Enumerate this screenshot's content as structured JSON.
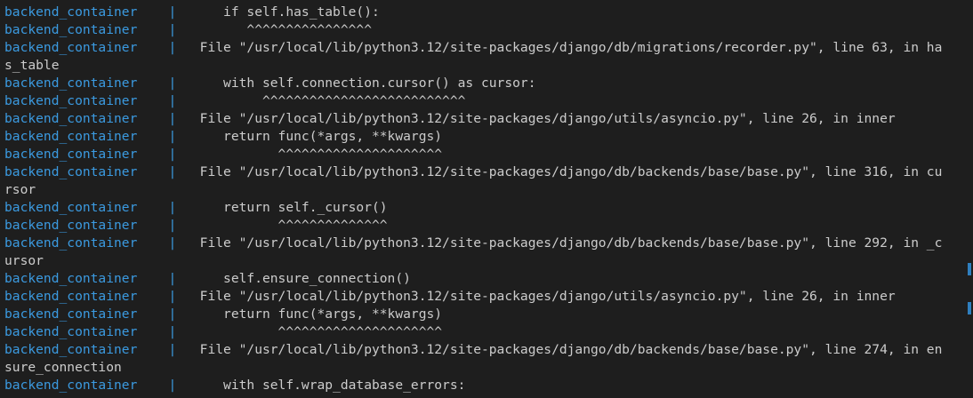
{
  "lines": [
    {
      "prefix": "backend_container",
      "pipe": "|",
      "text": "      if self.has_table():"
    },
    {
      "prefix": "backend_container",
      "pipe": "|",
      "text": "         ^^^^^^^^^^^^^^^^"
    },
    {
      "prefix": "backend_container",
      "pipe": "|",
      "text": "   File \"/usr/local/lib/python3.12/site-packages/django/db/migrations/recorder.py\", line 63, in ha"
    },
    {
      "prefix": "",
      "pipe": "",
      "text": "s_table"
    },
    {
      "prefix": "backend_container",
      "pipe": "|",
      "text": "      with self.connection.cursor() as cursor:"
    },
    {
      "prefix": "backend_container",
      "pipe": "|",
      "text": "           ^^^^^^^^^^^^^^^^^^^^^^^^^^"
    },
    {
      "prefix": "backend_container",
      "pipe": "|",
      "text": "   File \"/usr/local/lib/python3.12/site-packages/django/utils/asyncio.py\", line 26, in inner"
    },
    {
      "prefix": "backend_container",
      "pipe": "|",
      "text": "      return func(*args, **kwargs)"
    },
    {
      "prefix": "backend_container",
      "pipe": "|",
      "text": "             ^^^^^^^^^^^^^^^^^^^^^"
    },
    {
      "prefix": "backend_container",
      "pipe": "|",
      "text": "   File \"/usr/local/lib/python3.12/site-packages/django/db/backends/base/base.py\", line 316, in cu"
    },
    {
      "prefix": "",
      "pipe": "",
      "text": "rsor"
    },
    {
      "prefix": "backend_container",
      "pipe": "|",
      "text": "      return self._cursor()"
    },
    {
      "prefix": "backend_container",
      "pipe": "|",
      "text": "             ^^^^^^^^^^^^^^"
    },
    {
      "prefix": "backend_container",
      "pipe": "|",
      "text": "   File \"/usr/local/lib/python3.12/site-packages/django/db/backends/base/base.py\", line 292, in _c"
    },
    {
      "prefix": "",
      "pipe": "",
      "text": "ursor"
    },
    {
      "prefix": "backend_container",
      "pipe": "|",
      "text": "      self.ensure_connection()"
    },
    {
      "prefix": "backend_container",
      "pipe": "|",
      "text": "   File \"/usr/local/lib/python3.12/site-packages/django/utils/asyncio.py\", line 26, in inner"
    },
    {
      "prefix": "backend_container",
      "pipe": "|",
      "text": "      return func(*args, **kwargs)"
    },
    {
      "prefix": "backend_container",
      "pipe": "|",
      "text": "             ^^^^^^^^^^^^^^^^^^^^^"
    },
    {
      "prefix": "backend_container",
      "pipe": "|",
      "text": "   File \"/usr/local/lib/python3.12/site-packages/django/db/backends/base/base.py\", line 274, in en"
    },
    {
      "prefix": "",
      "pipe": "",
      "text": "sure_connection"
    },
    {
      "prefix": "backend_container",
      "pipe": "|",
      "text": "      with self.wrap_database_errors:"
    }
  ],
  "colors": {
    "background": "#1e1e1e",
    "prefix": "#3b9ae0",
    "text": "#cccccc"
  }
}
